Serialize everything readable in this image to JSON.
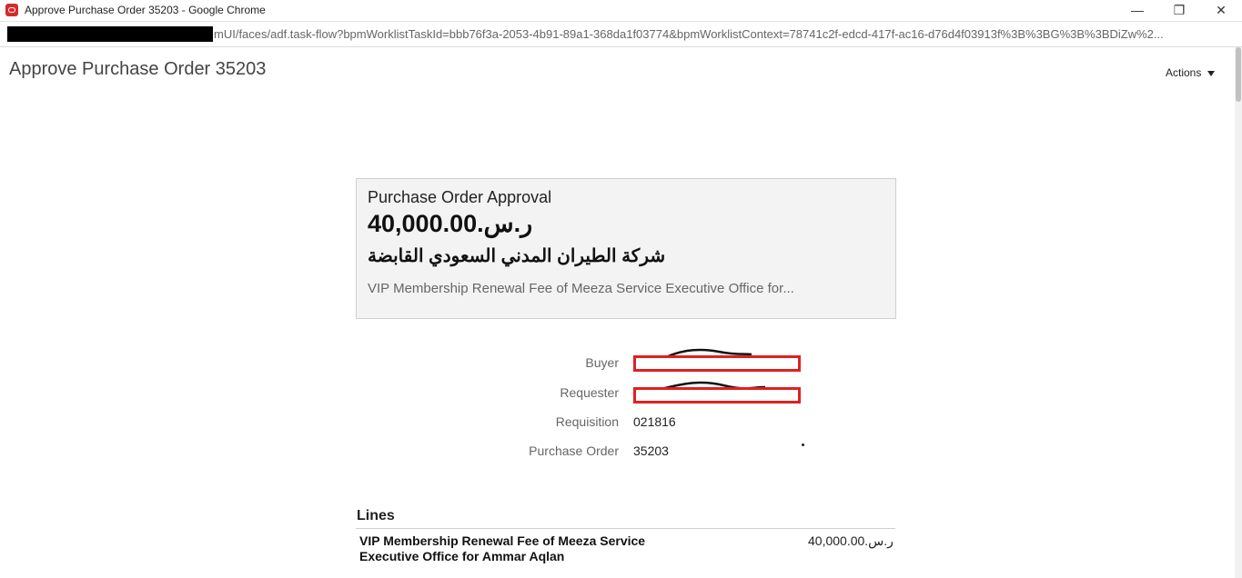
{
  "window": {
    "title": "Approve Purchase Order 35203 - Google Chrome",
    "controls": {
      "minimize": "—",
      "restore": "❐",
      "close": "✕"
    }
  },
  "address_bar": {
    "url_visible": "mUI/faces/adf.task-flow?bpmWorklistTaskId=bbb76f3a-2053-4b91-89a1-368da1f03774&bpmWorklistContext=78741c2f-edcd-417f-ac16-d76d4f03913f%3B%3BG%3B%3BDiZw%2..."
  },
  "page": {
    "title": "Approve Purchase Order 35203",
    "actions_label": "Actions"
  },
  "summary_card": {
    "heading": "Purchase Order Approval",
    "amount": "40,000.00.ر.س",
    "supplier": "شركة الطيران المدني السعودي القابضة",
    "description": "VIP Membership Renewal Fee of Meeza Service Executive Office for..."
  },
  "fields": {
    "buyer_label": "Buyer",
    "requester_label": "Requester",
    "requisition_label": "Requisition",
    "requisition_value": "021816",
    "purchase_order_label": "Purchase Order",
    "purchase_order_value": "35203"
  },
  "lines": {
    "heading": "Lines",
    "items": [
      {
        "description": "VIP Membership Renewal Fee of Meeza Service Executive Office for Ammar Aqlan",
        "amount": "40,000.00.ر.س"
      }
    ]
  },
  "colors": {
    "redaction": "#e02020",
    "card_bg": "#f3f3f3",
    "app_icon": "#d62b2b"
  }
}
